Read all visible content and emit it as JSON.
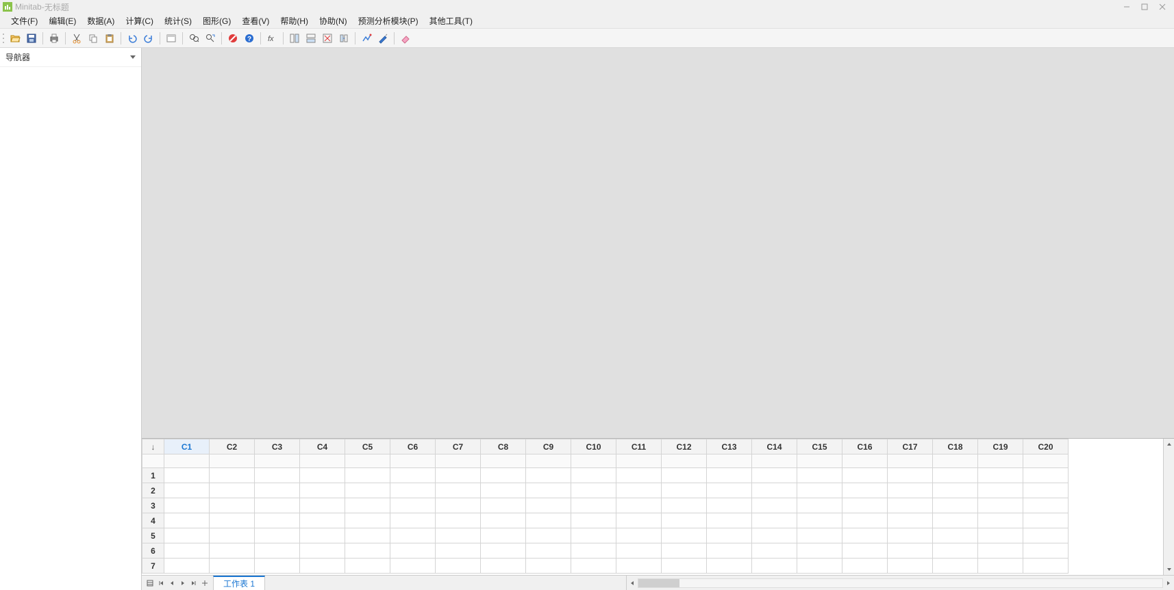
{
  "title": {
    "app": "Minitab",
    "separator": " - ",
    "doc": "无标题"
  },
  "menu": [
    "文件(F)",
    "编辑(E)",
    "数据(A)",
    "计算(C)",
    "统计(S)",
    "图形(G)",
    "查看(V)",
    "帮助(H)",
    "协助(N)",
    "预测分析模块(P)",
    "其他工具(T)"
  ],
  "navigator": {
    "title": "导航器"
  },
  "worksheet": {
    "columns": [
      "C1",
      "C2",
      "C3",
      "C4",
      "C5",
      "C6",
      "C7",
      "C8",
      "C9",
      "C10",
      "C11",
      "C12",
      "C13",
      "C14",
      "C15",
      "C16",
      "C17",
      "C18",
      "C19",
      "C20"
    ],
    "selected_column": "C1",
    "rows": [
      "1",
      "2",
      "3",
      "4",
      "5",
      "6",
      "7"
    ],
    "corner": "↓"
  },
  "sheet_tab": "工作表 1"
}
